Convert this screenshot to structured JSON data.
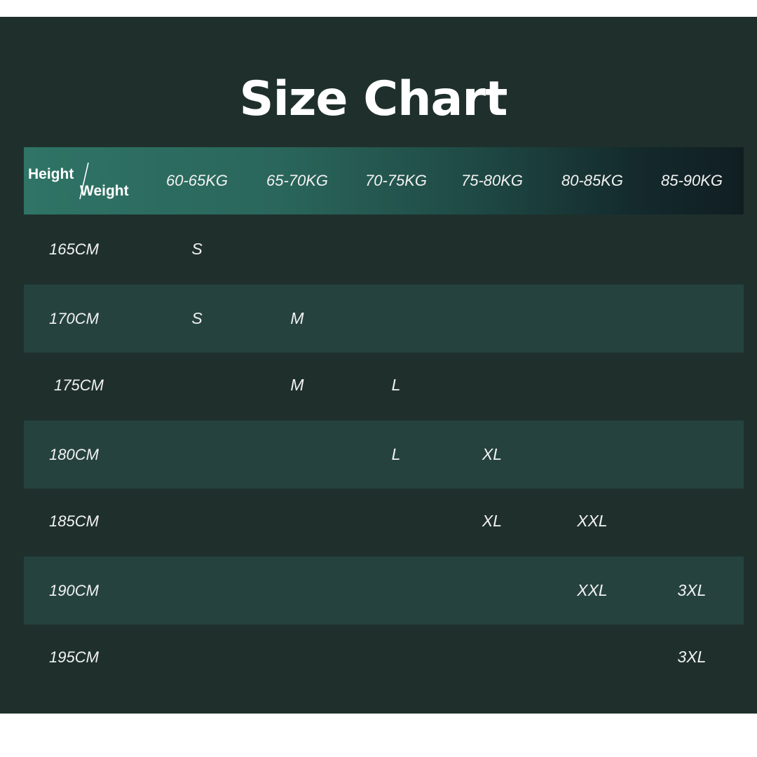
{
  "title": "Size Chart",
  "table": {
    "corner": {
      "top": "Height",
      "bottom": "Weight"
    },
    "columns": [
      "60-65KG",
      "65-70KG",
      "70-75KG",
      "75-80KG",
      "80-85KG",
      "85-90KG"
    ],
    "rows": [
      {
        "height": "165CM",
        "sizes": [
          "S",
          "",
          "",
          "",
          "",
          ""
        ]
      },
      {
        "height": "170CM",
        "sizes": [
          "S",
          "M",
          "",
          "",
          "",
          ""
        ]
      },
      {
        "height": "175CM",
        "sizes": [
          "",
          "M",
          "L",
          "",
          "",
          ""
        ]
      },
      {
        "height": "180CM",
        "sizes": [
          "",
          "",
          "L",
          "XL",
          "",
          ""
        ]
      },
      {
        "height": "185CM",
        "sizes": [
          "",
          "",
          "",
          "XL",
          "XXL",
          ""
        ]
      },
      {
        "height": "190CM",
        "sizes": [
          "",
          "",
          "",
          "",
          "XXL",
          "3XL"
        ]
      },
      {
        "height": "195CM",
        "sizes": [
          "",
          "",
          "",
          "",
          "",
          "3XL"
        ]
      }
    ]
  },
  "colors": {
    "background": "#1f302c",
    "row_shade": "#25423f",
    "header_gradient_start": "#2f7466",
    "header_gradient_end": "#101e22",
    "text": "#ffffff"
  }
}
